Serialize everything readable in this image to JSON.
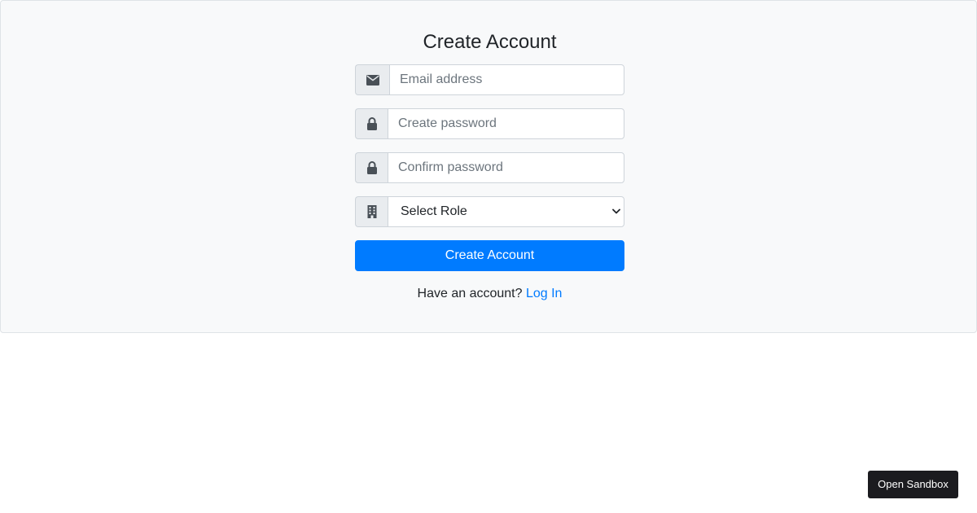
{
  "form": {
    "title": "Create Account",
    "fields": [
      {
        "icon": "envelope-icon",
        "placeholder": "Email address",
        "value": ""
      },
      {
        "icon": "lock-icon",
        "placeholder": "Create password",
        "value": ""
      },
      {
        "icon": "lock-icon",
        "placeholder": "Confirm password",
        "value": ""
      }
    ],
    "role_select": {
      "icon": "building-icon",
      "selected": "Select Role"
    },
    "submit_label": "Create Account",
    "login_prompt": "Have an account?",
    "login_link": "Log In"
  },
  "sandbox": {
    "label": "Open Sandbox"
  },
  "colors": {
    "primary": "#007bff",
    "card_background": "#f8f9fa",
    "addon_background": "#e9ecef",
    "sandbox_background": "#1b1b1f"
  }
}
